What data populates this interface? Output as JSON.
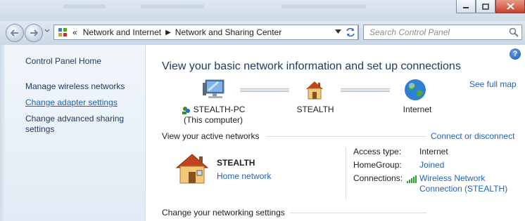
{
  "window": {
    "buttons": {
      "minimize": "minimize-icon",
      "maximize": "maximize-icon",
      "close": "close-icon"
    }
  },
  "address": {
    "overflow": "«",
    "crumbs": [
      "Network and Internet",
      "Network and Sharing Center"
    ],
    "search_placeholder": "Search Control Panel"
  },
  "sidebar": {
    "home": "Control Panel Home",
    "links": [
      "Manage wireless networks",
      "Change adapter settings",
      "Change advanced sharing settings"
    ]
  },
  "main": {
    "title": "View your basic network information and set up connections",
    "see_full_map": "See full map",
    "map": {
      "computer_name": "STEALTH-PC",
      "computer_sub": "(This computer)",
      "network_name": "STEALTH",
      "internet": "Internet"
    },
    "active_networks": {
      "heading": "View your active networks",
      "connect_link": "Connect or disconnect",
      "network_name": "STEALTH",
      "network_type": "Home network",
      "access_label": "Access type:",
      "access_value": "Internet",
      "homegroup_label": "HomeGroup:",
      "homegroup_value": "Joined",
      "connections_label": "Connections:",
      "connections_line1": "Wireless Network",
      "connections_line2": "Connection (STEALTH)"
    },
    "change_settings_heading": "Change your networking settings"
  },
  "colors": {
    "link": "#2463b7",
    "title": "#1e3a5c",
    "sidebar_bg": "#e8f0f8"
  }
}
